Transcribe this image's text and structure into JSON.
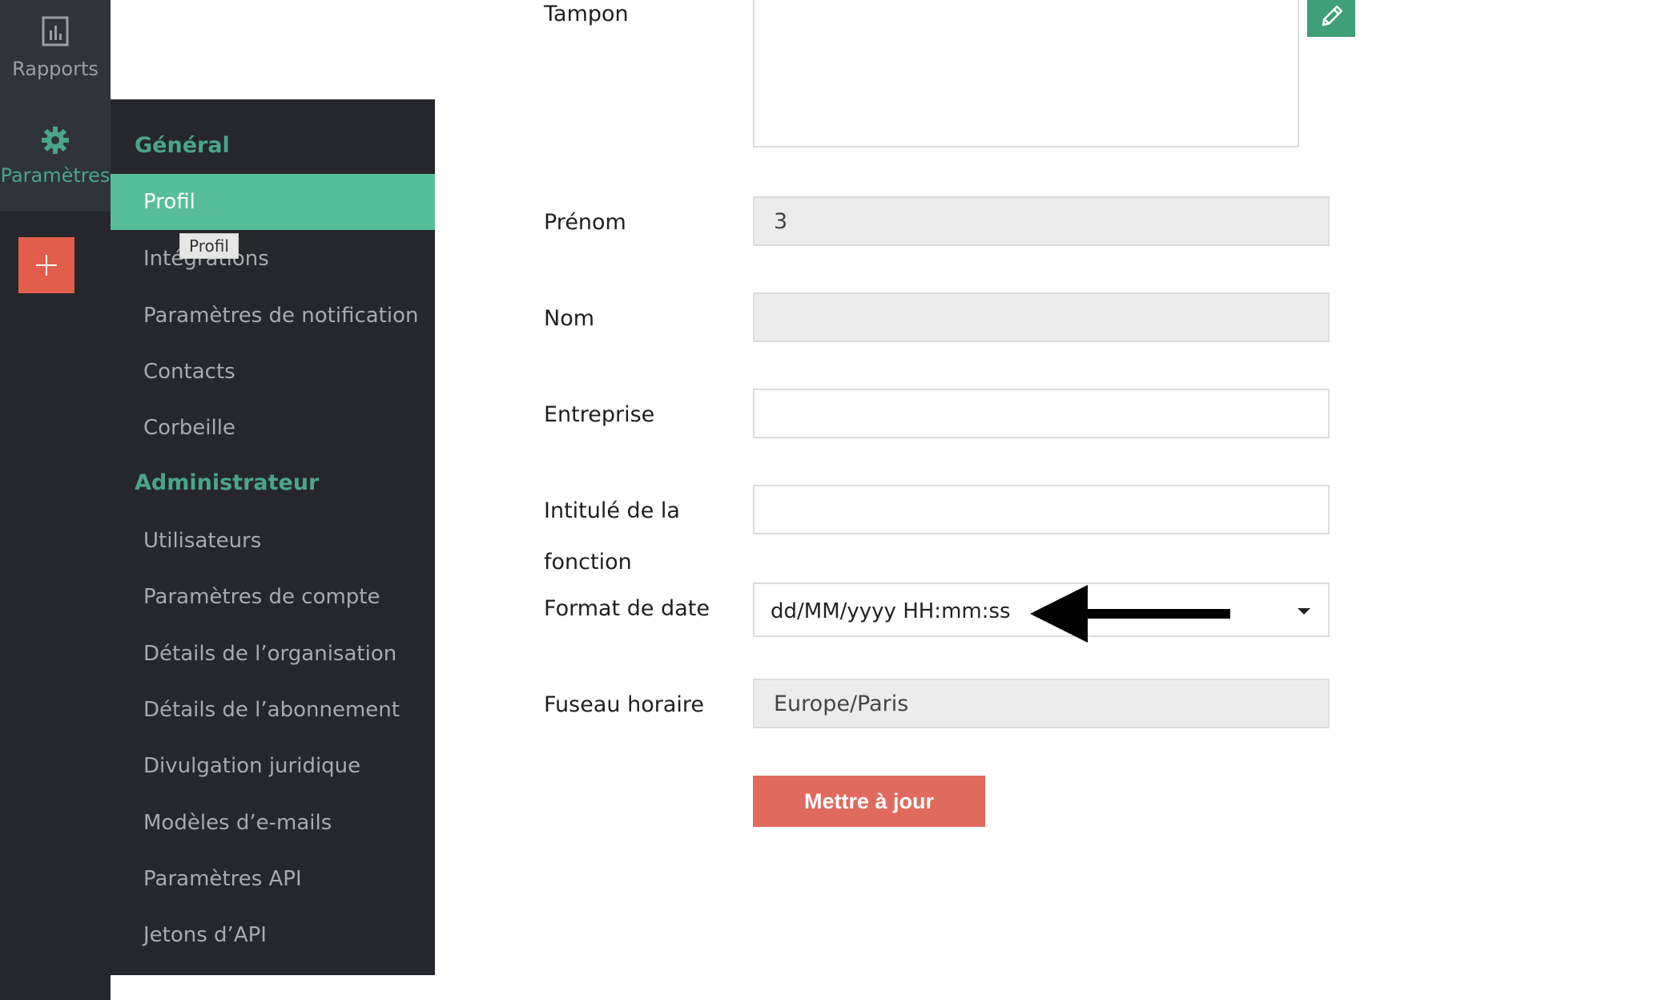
{
  "rail": {
    "reports_label": "Rapports",
    "settings_label": "Paramètres",
    "add_label": "+"
  },
  "submenu": {
    "general_title": "Général",
    "general_items": [
      "Profil",
      "Intégrations",
      "Paramètres de notification",
      "Contacts",
      "Corbeille"
    ],
    "admin_title": "Administrateur",
    "admin_items": [
      "Utilisateurs",
      "Paramètres de compte",
      "Détails de l’organisation",
      "Détails de l’abonnement",
      "Divulgation juridique",
      "Modèles d’e-mails",
      "Paramètres API",
      "Jetons d’API"
    ],
    "active_item": "Profil",
    "tooltip": "Profil"
  },
  "form": {
    "stamp_label": "Tampon",
    "first_name_label": "Prénom",
    "first_name_value": "3",
    "last_name_label": "Nom",
    "last_name_value": "",
    "company_label": "Entreprise",
    "company_value": "",
    "job_title_label_line1": "Intitulé de la",
    "job_title_label_line2": "fonction",
    "job_title_value": "",
    "date_format_label": "Format de date",
    "date_format_value": "dd/MM/yyyy HH:mm:ss",
    "timezone_label": "Fuseau horaire",
    "timezone_value": "Europe/Paris",
    "update_button": "Mettre à jour"
  },
  "colors": {
    "rail_bg": "#25272c",
    "accent_green": "#4ba588",
    "active_item_bg": "#58bd9b",
    "add_button": "#e15e4b",
    "update_button": "#e06a5e"
  }
}
